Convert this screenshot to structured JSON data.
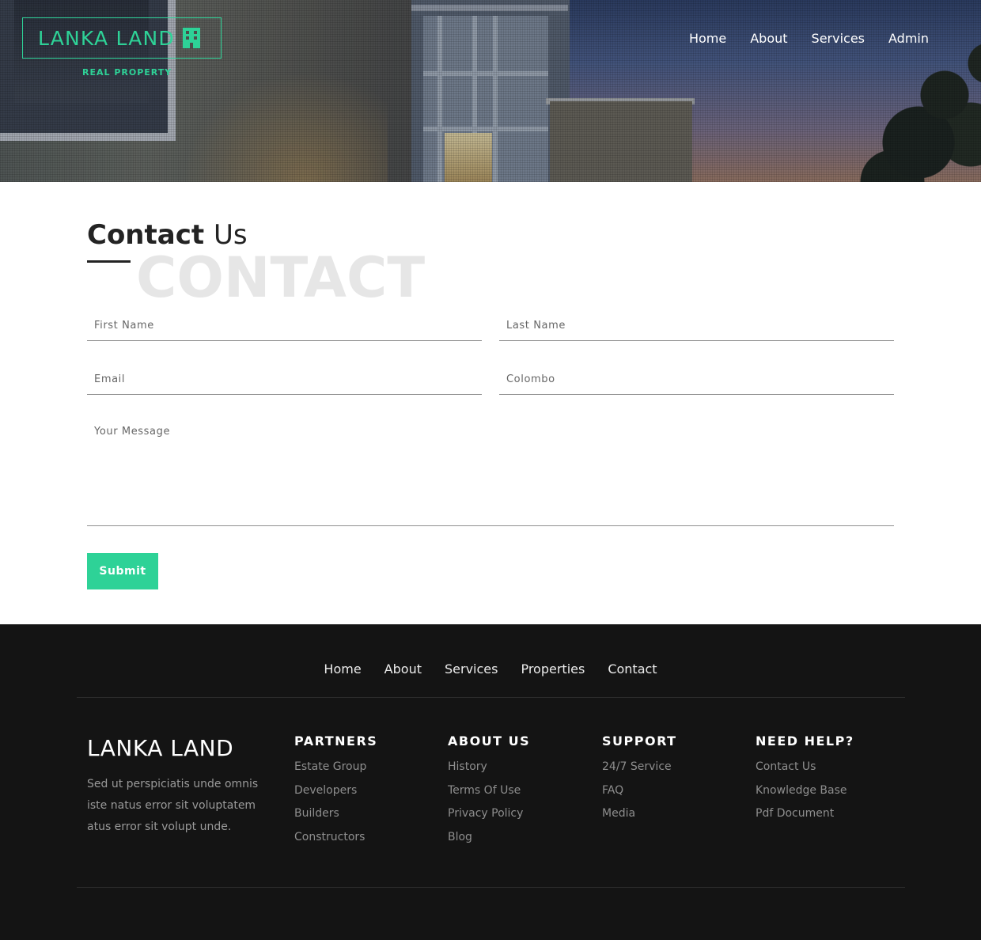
{
  "header": {
    "brand_name": "LANKA LAND",
    "brand_tagline": "REAL PROPERTY",
    "nav": [
      "Home",
      "About",
      "Services",
      "Admin"
    ]
  },
  "contact": {
    "title_bold": "Contact",
    "title_light": "Us",
    "background_word": "CONTACT",
    "fields": {
      "first_name_placeholder": "First Name",
      "last_name_placeholder": "Last Name",
      "email_placeholder": "Email",
      "city_placeholder": "Colombo",
      "message_placeholder": "Your Message"
    },
    "submit_label": "Submit"
  },
  "footer": {
    "nav": [
      "Home",
      "About",
      "Services",
      "Properties",
      "Contact"
    ],
    "brand": "LANKA LAND",
    "description": "Sed ut perspiciatis unde omnis iste natus error sit voluptatem atus error sit volupt unde.",
    "columns": [
      {
        "title": "PARTNERS",
        "links": [
          "Estate Group",
          "Developers",
          "Builders",
          "Constructors"
        ]
      },
      {
        "title": "ABOUT US",
        "links": [
          "History",
          "Terms Of Use",
          "Privacy Policy",
          "Blog"
        ]
      },
      {
        "title": "SUPPORT",
        "links": [
          "24/7 Service",
          "FAQ",
          "Media"
        ]
      },
      {
        "title": "NEED HELP?",
        "links": [
          "Contact Us",
          "Knowledge Base",
          "Pdf Document"
        ]
      }
    ]
  },
  "colors": {
    "accent": "#2ed297",
    "footer_bg": "#141414",
    "text_dark": "#232323"
  },
  "icons": {
    "brand_icon": "building-icon"
  }
}
